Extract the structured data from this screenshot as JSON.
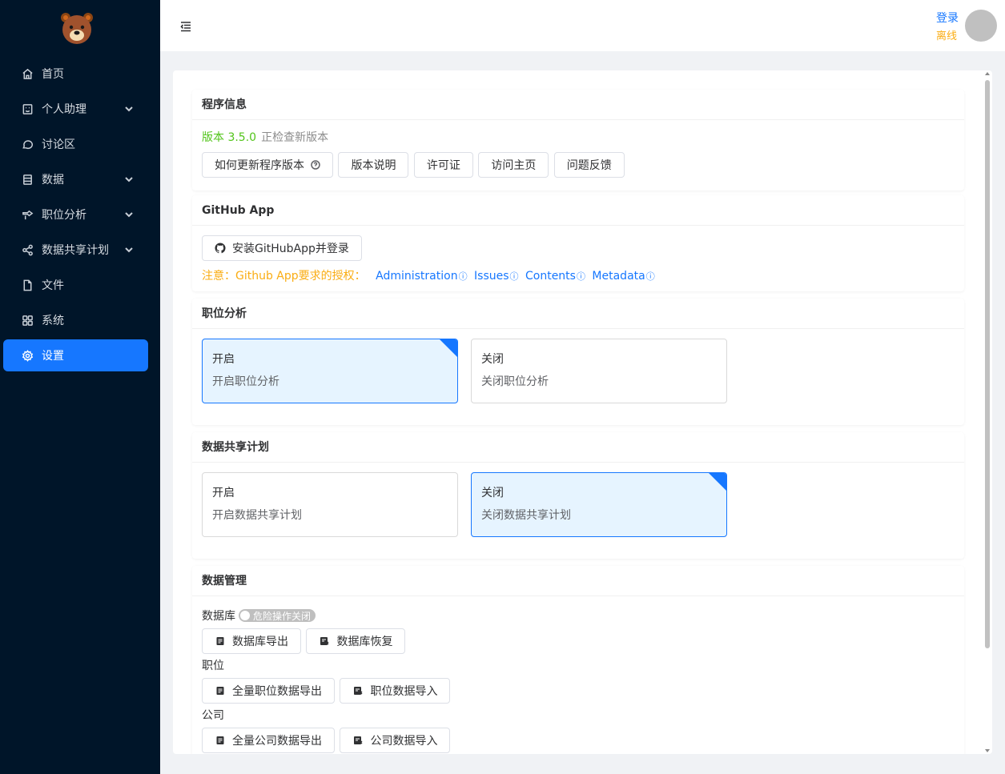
{
  "sidebar": {
    "items": [
      {
        "label": "首页",
        "icon": "home-icon",
        "has_children": false
      },
      {
        "label": "个人助理",
        "icon": "assistant-icon",
        "has_children": true
      },
      {
        "label": "讨论区",
        "icon": "chat-icon",
        "has_children": false
      },
      {
        "label": "数据",
        "icon": "data-icon",
        "has_children": true
      },
      {
        "label": "职位分析",
        "icon": "analysis-icon",
        "has_children": true
      },
      {
        "label": "数据共享计划",
        "icon": "share-icon",
        "has_children": true
      },
      {
        "label": "文件",
        "icon": "file-icon",
        "has_children": false
      },
      {
        "label": "系统",
        "icon": "system-icon",
        "has_children": false
      },
      {
        "label": "设置",
        "icon": "gear-icon",
        "has_children": false,
        "active": true
      }
    ]
  },
  "header": {
    "login_label": "登录",
    "status_label": "离线"
  },
  "program_info": {
    "title": "程序信息",
    "version": "版本 3.5.0",
    "check_text": "正检查新版本",
    "buttons": [
      "如何更新程序版本",
      "版本说明",
      "许可证",
      "访问主页",
      "问题反馈"
    ]
  },
  "github_app": {
    "title": "GitHub App",
    "install_button": "安装GitHubApp并登录",
    "note": "注意：Github App要求的授权：",
    "permissions": [
      "Administration",
      "Issues",
      "Contents",
      "Metadata"
    ],
    "info_glyph": "ⓘ"
  },
  "job_analysis": {
    "title": "职位分析",
    "options": [
      {
        "title": "开启",
        "desc": "开启职位分析",
        "selected": true
      },
      {
        "title": "关闭",
        "desc": "关闭职位分析",
        "selected": false
      }
    ]
  },
  "data_share": {
    "title": "数据共享计划",
    "options": [
      {
        "title": "开启",
        "desc": "开启数据共享计划",
        "selected": false
      },
      {
        "title": "关闭",
        "desc": "关闭数据共享计划",
        "selected": true
      }
    ]
  },
  "data_management": {
    "title": "数据管理",
    "database_label": "数据库",
    "danger_switch": "危险操作关闭",
    "db_export": "数据库导出",
    "db_restore": "数据库恢复",
    "job_label": "职位",
    "job_export": "全量职位数据导出",
    "job_import": "职位数据导入",
    "company_label": "公司",
    "company_export": "全量公司数据导出",
    "company_import": "公司数据导入"
  },
  "colors": {
    "sidebar_bg": "#001529",
    "accent": "#1677ff",
    "success": "#52c41a",
    "warning": "#faad14"
  }
}
